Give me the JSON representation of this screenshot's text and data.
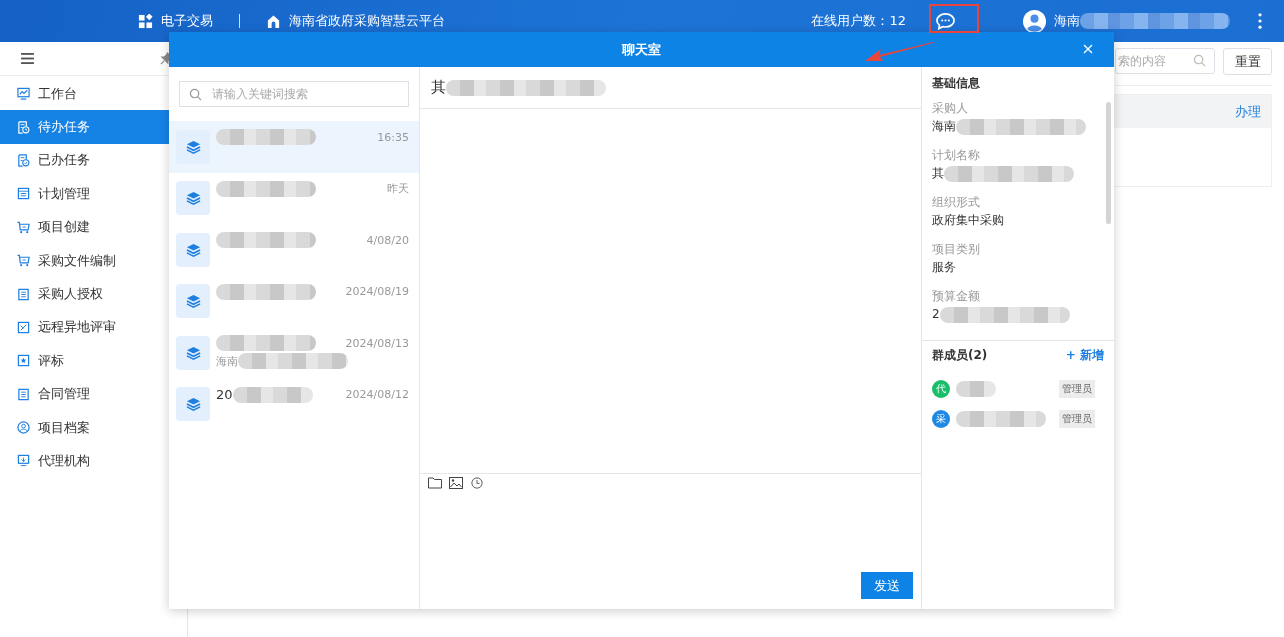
{
  "header": {
    "app": "电子交易",
    "platform": "海南省政府采购智慧云平台",
    "online_label": "在线用户数：",
    "online_count": "12",
    "user": "海南",
    "user_redacted": true
  },
  "sidebar": {
    "items": [
      {
        "label": "工作台",
        "selected": false
      },
      {
        "label": "待办任务",
        "selected": true
      },
      {
        "label": "已办任务",
        "selected": false
      },
      {
        "label": "计划管理",
        "selected": false
      },
      {
        "label": "项目创建",
        "selected": false
      },
      {
        "label": "采购文件编制",
        "selected": false
      },
      {
        "label": "采购人授权",
        "selected": false
      },
      {
        "label": "远程异地评审",
        "selected": false
      },
      {
        "label": "评标",
        "selected": false
      },
      {
        "label": "合同管理",
        "selected": false
      },
      {
        "label": "项目档案",
        "selected": false
      },
      {
        "label": "代理机构",
        "selected": false
      }
    ]
  },
  "background_page": {
    "search_placeholder": "索的内容",
    "reset_button": "重置",
    "action_link": "办理"
  },
  "chat": {
    "title": "聊天室",
    "search_placeholder": "请输入关键词搜索",
    "conversations": [
      {
        "time": "16:35",
        "selected": true,
        "redacted": true
      },
      {
        "time": "昨天",
        "selected": false,
        "redacted": true
      },
      {
        "time": "4/08/20",
        "selected": false,
        "redacted": true
      },
      {
        "time": "2024/08/19",
        "selected": false,
        "redacted": true
      },
      {
        "time": "2024/08/13",
        "subtitle": "海南",
        "selected": false,
        "redacted": true
      },
      {
        "name": "20",
        "time": "2024/08/12",
        "selected": false,
        "redacted": true
      }
    ],
    "current_title": "其",
    "current_title_redacted": true,
    "send_button": "发送",
    "info_heading": "基础信息",
    "info": [
      {
        "label": "采购人",
        "value": "海南",
        "redacted": true
      },
      {
        "label": "计划名称",
        "value": "其",
        "redacted": true
      },
      {
        "label": "组织形式",
        "value": "政府集中采购",
        "redacted": false
      },
      {
        "label": "项目类别",
        "value": "服务",
        "redacted": false
      },
      {
        "label": "预算金额",
        "value": "2",
        "redacted": true
      }
    ],
    "members_heading": "群成员(2)",
    "add_member": "+ 新增",
    "members": [
      {
        "avatar": "代",
        "color": "#19be6b",
        "role": "管理员",
        "redacted": true
      },
      {
        "avatar": "采",
        "color": "#1e88e5",
        "role": "管理员",
        "redacted": true
      }
    ]
  }
}
